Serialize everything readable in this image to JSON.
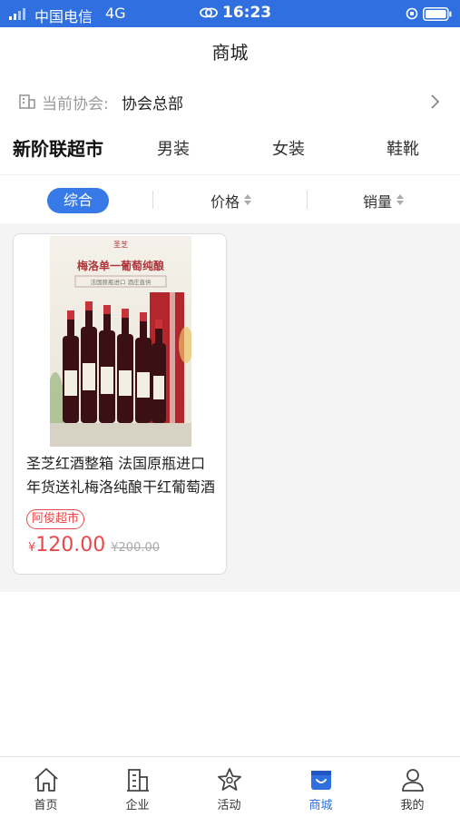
{
  "status_bar": {
    "carrier": "中国电信",
    "network": "4G",
    "time": "16:23",
    "icons": [
      "signal-icon",
      "link-icon",
      "orientation-lock-icon",
      "battery-icon"
    ]
  },
  "nav": {
    "title": "商城"
  },
  "association": {
    "label": "当前协会:",
    "value": "协会总部",
    "icon": "org-icon"
  },
  "categories": [
    {
      "label": "新阶联超市",
      "active": true
    },
    {
      "label": "男装",
      "active": false
    },
    {
      "label": "女装",
      "active": false
    },
    {
      "label": "鞋靴",
      "active": false
    }
  ],
  "sort": {
    "all_label": "综合",
    "price_label": "价格",
    "sales_label": "销量"
  },
  "products": [
    {
      "image_banner": "梅洛单一葡萄纯酿",
      "image_sub": "法国原瓶进口  酒庄直供",
      "image_brand": "圣芝",
      "name_line1": "圣芝红酒整箱 法国原瓶进口",
      "name_line2": "年货送礼梅洛纯酿干红葡萄酒",
      "shop": "阿俊超市",
      "currency": "¥",
      "price": "120.00",
      "original_price": "¥200.00"
    }
  ],
  "tabbar": [
    {
      "label": "首页",
      "icon": "home-icon",
      "active": false
    },
    {
      "label": "企业",
      "icon": "building-icon",
      "active": false
    },
    {
      "label": "活动",
      "icon": "star-icon",
      "active": false
    },
    {
      "label": "商城",
      "icon": "shop-bag-icon",
      "active": true
    },
    {
      "label": "我的",
      "icon": "user-icon",
      "active": false
    }
  ],
  "colors": {
    "accent": "#2f6fe0",
    "price": "#e8484b",
    "background": "#f4f4f4"
  }
}
